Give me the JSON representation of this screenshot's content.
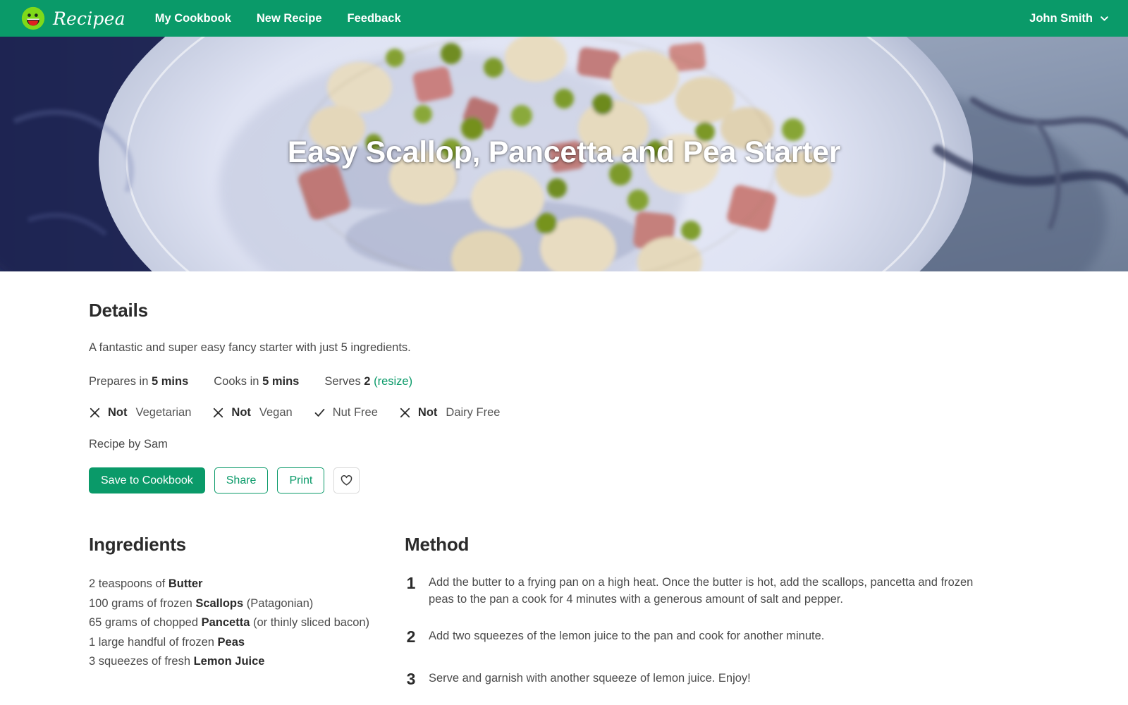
{
  "navbar": {
    "brand_name": "Recipea",
    "brand_icon": "smiley-face-logo",
    "links": [
      {
        "label": "My Cookbook",
        "name": "my-cookbook"
      },
      {
        "label": "New Recipe",
        "name": "new-recipe"
      },
      {
        "label": "Feedback",
        "name": "feedback"
      }
    ],
    "user_name": "John Smith",
    "user_chevron_icon": "chevron-down-icon",
    "background_color": "#0a9a69"
  },
  "hero": {
    "title": "Easy Scallop, Pancetta and Pea Starter",
    "image_alt": "Plate of seared scallops with pancetta cubes and green peas"
  },
  "details": {
    "heading": "Details",
    "description": "A fantastic and super easy fancy starter with just 5 ingredients.",
    "prepares_label": "Prepares in",
    "prepares_value": "5 mins",
    "cooks_label": "Cooks in",
    "cooks_value": "5 mins",
    "serves_label": "Serves",
    "serves_value": "2",
    "resize_label": "(resize)",
    "diet": [
      {
        "icon": "x-icon",
        "prefix": "Not",
        "label": "Vegetarian",
        "name": "vegetarian"
      },
      {
        "icon": "x-icon",
        "prefix": "Not",
        "label": "Vegan",
        "name": "vegan"
      },
      {
        "icon": "check-icon",
        "prefix": "",
        "label": "Nut Free",
        "name": "nut-free"
      },
      {
        "icon": "x-icon",
        "prefix": "Not",
        "label": "Dairy Free",
        "name": "dairy-free"
      }
    ],
    "byline": "Recipe by Sam",
    "buttons": {
      "save_label": "Save to Cookbook",
      "share_label": "Share",
      "print_label": "Print",
      "favorite_icon": "heart-icon"
    }
  },
  "ingredients": {
    "heading": "Ingredients",
    "items": [
      {
        "pre": "2 teaspoons of ",
        "name": "Butter",
        "post": ""
      },
      {
        "pre": "100 grams of frozen ",
        "name": "Scallops",
        "post": " (Patagonian)"
      },
      {
        "pre": "65 grams of chopped ",
        "name": "Pancetta",
        "post": " (or thinly sliced bacon)"
      },
      {
        "pre": "1 large handful of frozen ",
        "name": "Peas",
        "post": ""
      },
      {
        "pre": "3 squeezes of fresh ",
        "name": "Lemon Juice",
        "post": ""
      }
    ]
  },
  "method": {
    "heading": "Method",
    "steps": [
      {
        "num": "1",
        "text": "Add the butter to a frying pan on a high heat. Once the butter is hot, add the scallops, pancetta and frozen peas to the pan a cook for 4 minutes with a generous amount of salt and pepper."
      },
      {
        "num": "2",
        "text": "Add two squeezes of the lemon juice to the pan and cook for another minute."
      },
      {
        "num": "3",
        "text": "Serve and garnish with another squeeze of lemon juice. Enjoy!"
      }
    ]
  },
  "colors": {
    "brand_green": "#0a9a69",
    "logo_green": "#7fd91a",
    "logo_mouth_red": "#e02020",
    "text_dark": "#2b2b2b",
    "text_body": "#4a4a4a"
  }
}
